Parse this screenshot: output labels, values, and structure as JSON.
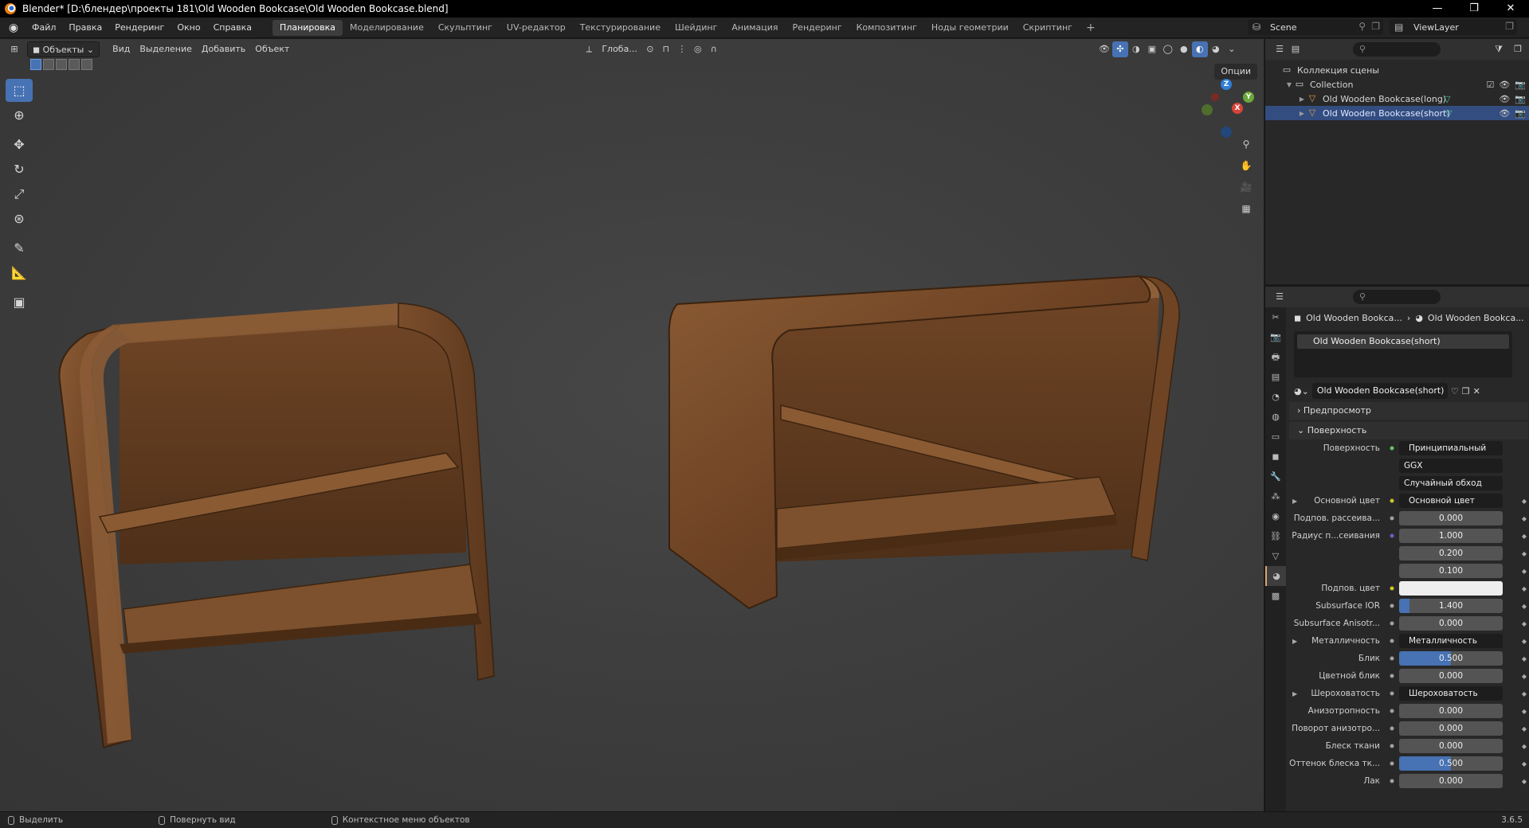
{
  "window": {
    "title": "Blender* [D:\\блендер\\проекты 181\\Old Wooden Bookcase\\Old Wooden Bookcase.blend]",
    "controls": [
      "—",
      "❐",
      "✕"
    ]
  },
  "menu": [
    "Файл",
    "Правка",
    "Рендеринг",
    "Окно",
    "Справка"
  ],
  "workspaces": [
    "Планировка",
    "Моделирование",
    "Скульптинг",
    "UV-редактор",
    "Текстурирование",
    "Шейдинг",
    "Анимация",
    "Рендеринг",
    "Композитинг",
    "Ноды геометрии",
    "Скриптинг"
  ],
  "active_workspace": "Планировка",
  "scene": "Scene",
  "view_layer": "ViewLayer",
  "viewport": {
    "mode": "Объекты",
    "menus": [
      "Вид",
      "Выделение",
      "Добавить",
      "Объект"
    ],
    "transform_orientation": "Глоба...",
    "options": "Опции",
    "gizmo": {
      "x": "X",
      "y": "Y",
      "z": "Z"
    }
  },
  "outliner": {
    "root": "Коллекция сцены",
    "collection": "Collection",
    "objects": [
      {
        "name": "Old Wooden Bookcase(long)",
        "selected": false
      },
      {
        "name": "Old Wooden Bookcase(short)",
        "selected": true
      }
    ]
  },
  "properties": {
    "breadcrumb_object": "Old Wooden Bookca...",
    "breadcrumb_material": "Old Wooden Bookca...",
    "slot": "Old Wooden Bookcase(short)",
    "material": "Old Wooden Bookcase(short)",
    "panels": {
      "preview": "Предпросмотр",
      "surface": "Поверхность"
    },
    "surface_label": "Поверхность",
    "surface_value": "Принципиальный BSDF",
    "distribution": "GGX",
    "subsurface_method": "Случайный обход",
    "rows": [
      {
        "label": "Основной цвет",
        "value": "Основной цвет",
        "kind": "link",
        "expand": true,
        "dot": "y"
      },
      {
        "label": "Подпов. рассеива...",
        "value": "0.000",
        "kind": "num",
        "dot": "gr"
      },
      {
        "label": "Радиус п...сеивания",
        "value": "1.000",
        "kind": "num",
        "dot": "b"
      },
      {
        "label": "",
        "value": "0.200",
        "kind": "num",
        "dot": ""
      },
      {
        "label": "",
        "value": "0.100",
        "kind": "num",
        "dot": ""
      },
      {
        "label": "Подпов. цвет",
        "value": "",
        "kind": "white",
        "dot": "y"
      },
      {
        "label": "Subsurface IOR",
        "value": "1.400",
        "kind": "bar",
        "fill": 0.1,
        "dot": "gr"
      },
      {
        "label": "Subsurface Anisotr...",
        "value": "0.000",
        "kind": "num",
        "dot": "gr"
      },
      {
        "label": "Металличность",
        "value": "Металличность",
        "kind": "link",
        "expand": true,
        "dot": "gr"
      },
      {
        "label": "Блик",
        "value": "0.500",
        "kind": "bar",
        "fill": 0.5,
        "dot": "gr"
      },
      {
        "label": "Цветной блик",
        "value": "0.000",
        "kind": "num",
        "dot": "gr"
      },
      {
        "label": "Шероховатость",
        "value": "Шероховатость",
        "kind": "link",
        "expand": true,
        "dot": "gr"
      },
      {
        "label": "Анизотропность",
        "value": "0.000",
        "kind": "num",
        "dot": "gr"
      },
      {
        "label": "Поворот анизотро...",
        "value": "0.000",
        "kind": "num",
        "dot": "gr"
      },
      {
        "label": "Блеск ткани",
        "value": "0.000",
        "kind": "num",
        "dot": "gr"
      },
      {
        "label": "Оттенок блеска тк...",
        "value": "0.500",
        "kind": "bar",
        "fill": 0.5,
        "dot": "gr"
      },
      {
        "label": "Лак",
        "value": "0.000",
        "kind": "num",
        "dot": "gr"
      }
    ]
  },
  "status": {
    "select": "Выделить",
    "rotate": "Повернуть вид",
    "context": "Контекстное меню объектов",
    "version": "3.6.5"
  }
}
